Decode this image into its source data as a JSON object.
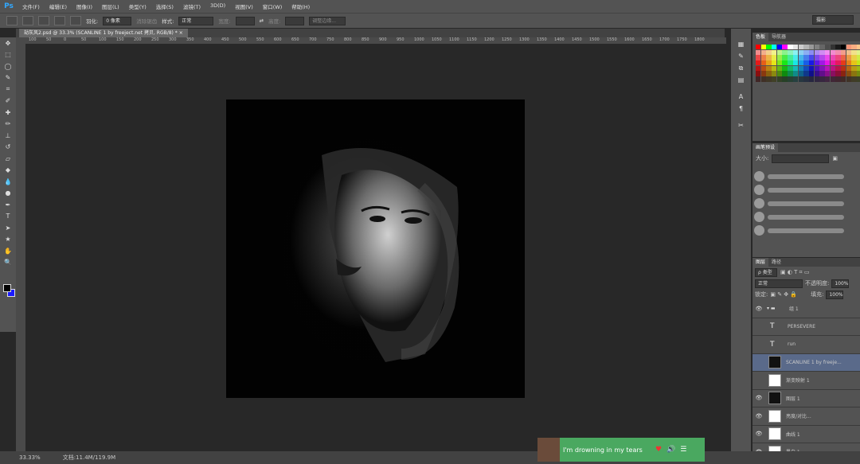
{
  "app": {
    "logo": "Ps"
  },
  "menu": [
    "文件(F)",
    "编辑(E)",
    "图像(I)",
    "图层(L)",
    "类型(Y)",
    "选择(S)",
    "滤镜(T)",
    "3D(D)",
    "视图(V)",
    "窗口(W)",
    "帮助(H)"
  ],
  "options": {
    "feather_label": "羽化:",
    "feather_value": "0 像素",
    "antialias_label": "消除锯齿",
    "style_label": "样式:",
    "style_value": "正常",
    "width_label": "宽度:",
    "height_label": "高度:",
    "refine_button": "调整边缘...",
    "workspace": "摄影"
  },
  "document": {
    "tab_title": "劫灰风2.psd @ 33.3% (SCANLINE 1 by freeject.net 拷贝, RGB/8) *",
    "close": "×"
  },
  "ruler_ticks": [
    "100",
    "50",
    "0",
    "50",
    "100",
    "150",
    "200",
    "250",
    "300",
    "350",
    "400",
    "450",
    "500",
    "550",
    "600",
    "650",
    "700",
    "750",
    "800",
    "850",
    "900",
    "950",
    "1000",
    "1050",
    "1100",
    "1150",
    "1200",
    "1250",
    "1300",
    "1350",
    "1400",
    "1450",
    "1500",
    "1550",
    "1600",
    "1650",
    "1700",
    "1750",
    "1800"
  ],
  "status": {
    "zoom": "33.33%",
    "doc_size": "文档:11.4M/119.9M"
  },
  "panels": {
    "swatches_tabs": [
      "色板",
      "导航器"
    ],
    "brush_tabs": [
      "画笔预设"
    ],
    "brush_size_label": "大小:",
    "layers_tabs": [
      "图层",
      "路径"
    ],
    "kind_label": "ρ 类型",
    "blend_mode": "正常",
    "opacity_label": "不透明度:",
    "opacity_value": "100%",
    "lock_label": "锁定:",
    "fill_label": "填充:",
    "fill_value": "100%"
  },
  "layers": [
    {
      "name": "组 1",
      "type": "group",
      "eye": "👁"
    },
    {
      "name": "PERSEVERE",
      "type": "text",
      "eye": ""
    },
    {
      "name": "run",
      "type": "text",
      "eye": ""
    },
    {
      "name": "SCANLINE 1 by freeje...",
      "type": "pixel",
      "eye": "",
      "selected": true
    },
    {
      "name": "渐变映射 1",
      "type": "adj",
      "eye": ""
    },
    {
      "name": "图层 1",
      "type": "pixel",
      "eye": "👁"
    },
    {
      "name": "亮度/对比...",
      "type": "adj",
      "eye": "👁"
    },
    {
      "name": "曲线 1",
      "type": "adj",
      "eye": "👁"
    },
    {
      "name": "黑白 1",
      "type": "adj",
      "eye": "👁"
    }
  ],
  "notification": {
    "text": "I'm drowning in my tears",
    "heart": "♥",
    "volume": "🔊",
    "list": "☰"
  },
  "colors": {
    "accent": "#31a8ff",
    "bg_swatch": "#1a1aff",
    "notif": "#4aa860"
  }
}
